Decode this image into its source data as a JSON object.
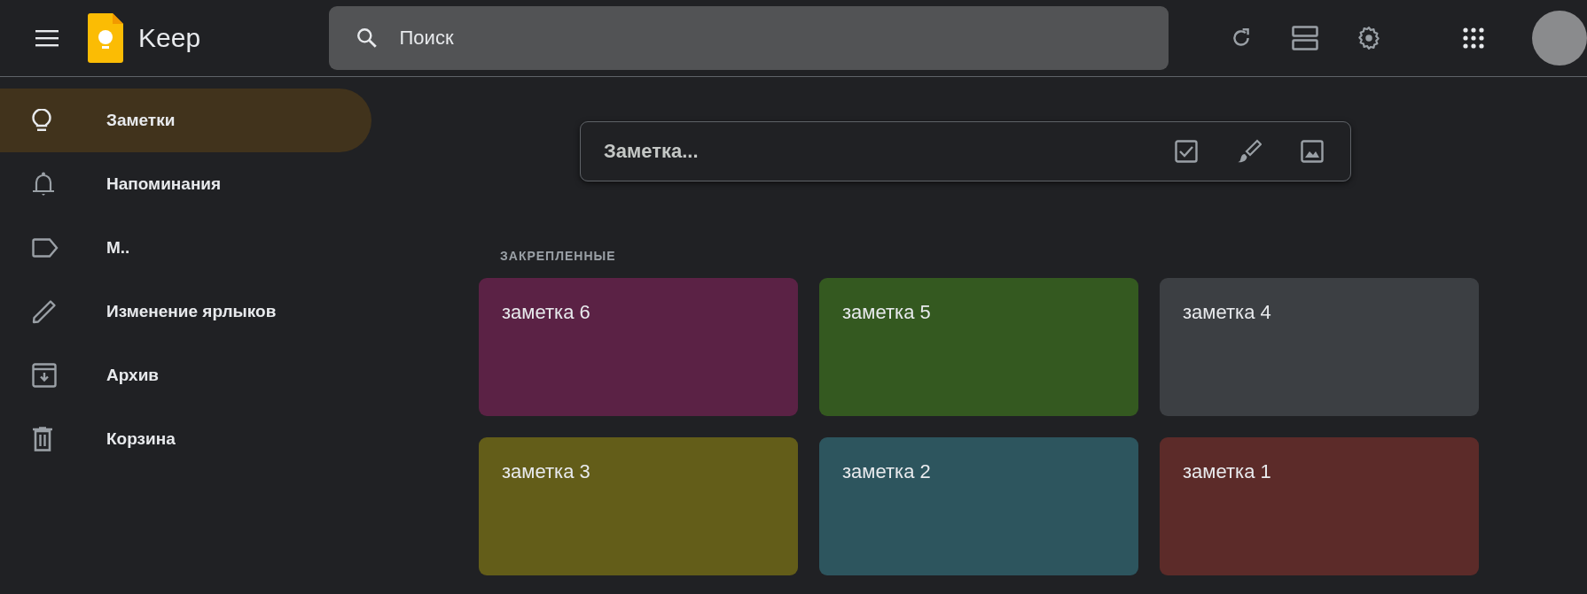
{
  "header": {
    "app_name": "Keep",
    "search": {
      "placeholder": "Поиск"
    }
  },
  "sidebar": {
    "items": [
      {
        "label": "Заметки",
        "selected": true
      },
      {
        "label": "Напоминания",
        "selected": false
      },
      {
        "label": "М..",
        "selected": false
      },
      {
        "label": "Изменение ярлыков",
        "selected": false
      },
      {
        "label": "Архив",
        "selected": false
      },
      {
        "label": "Корзина",
        "selected": false
      }
    ]
  },
  "note_input": {
    "placeholder": "Заметка..."
  },
  "pinned": {
    "heading": "ЗАКРЕПЛЕННЫЕ",
    "notes": [
      {
        "title": "заметка 6",
        "color": "#5b2245"
      },
      {
        "title": "заметка 5",
        "color": "#345920"
      },
      {
        "title": "заметка 4",
        "color": "#3c3f43"
      },
      {
        "title": "заметка 3",
        "color": "#635d19"
      },
      {
        "title": "заметка 2",
        "color": "#2d555e"
      },
      {
        "title": "заметка 1",
        "color": "#5c2b29"
      }
    ]
  }
}
